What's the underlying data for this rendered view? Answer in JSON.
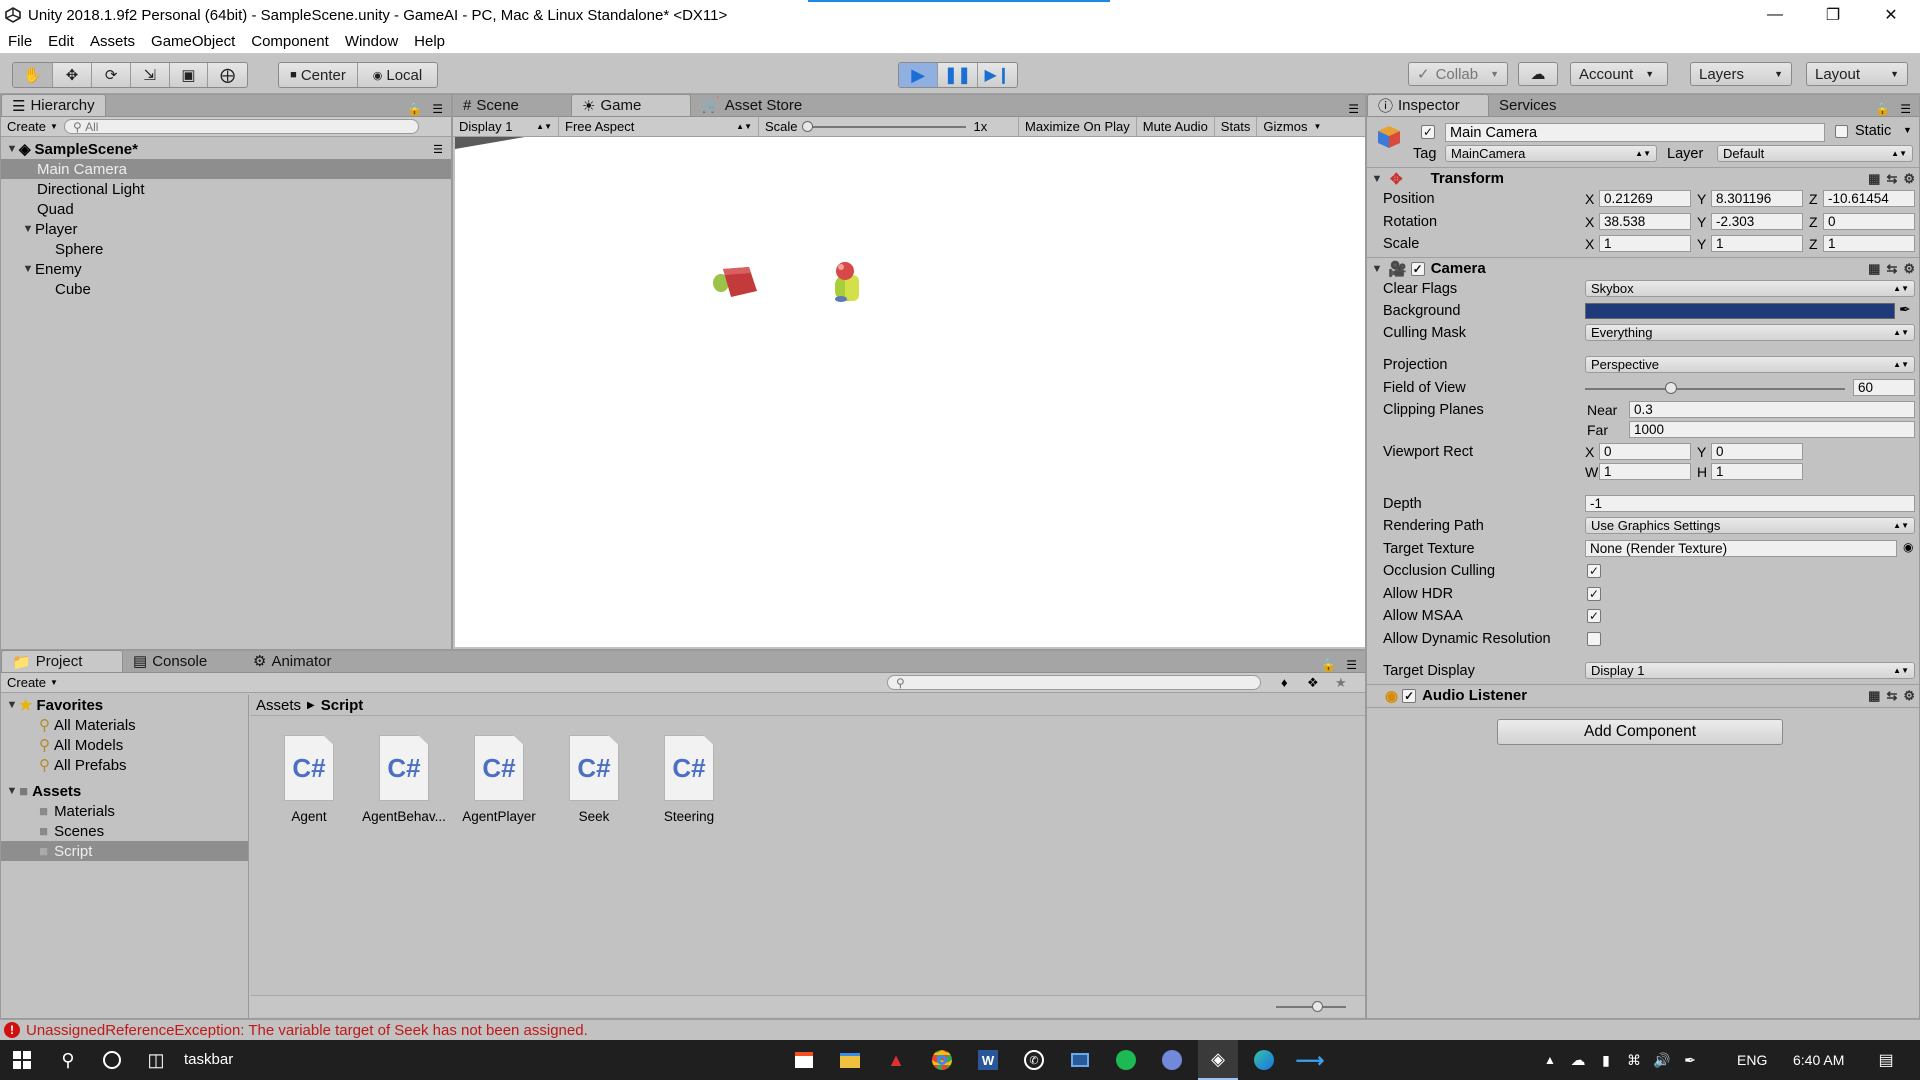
{
  "window": {
    "title": "Unity 2018.1.9f2 Personal (64bit) - SampleScene.unity - GameAI - PC, Mac & Linux Standalone* <DX11>",
    "min_icon": "minimize-icon",
    "max_icon": "restore-icon",
    "close_icon": "close-icon"
  },
  "menu": [
    "File",
    "Edit",
    "Assets",
    "GameObject",
    "Component",
    "Window",
    "Help"
  ],
  "toolbar": {
    "tools": [
      "hand-icon",
      "move-icon",
      "rotate-icon",
      "scale-icon",
      "rect-icon",
      "transform-icon"
    ],
    "pivot": "Center",
    "space": "Local",
    "play_state": "playing",
    "collab": "Collab",
    "account": "Account",
    "layers": "Layers",
    "layout": "Layout"
  },
  "hierarchy": {
    "tab": "Hierarchy",
    "create": "Create",
    "search_placeholder": "All",
    "scene": "SampleScene*",
    "items": [
      {
        "label": "Main Camera",
        "selected": true
      },
      {
        "label": "Directional Light"
      },
      {
        "label": "Quad"
      },
      {
        "label": "Player"
      },
      {
        "label": "Sphere"
      },
      {
        "label": "Enemy"
      },
      {
        "label": "Cube"
      }
    ]
  },
  "center_tabs": {
    "scene": "Scene",
    "game": "Game",
    "store": "Asset Store"
  },
  "game_toolbar": {
    "display": "Display 1",
    "aspect": "Free Aspect",
    "scale_label": "Scale",
    "scale_value": "1x",
    "maximize": "Maximize On Play",
    "mute": "Mute Audio",
    "stats": "Stats",
    "gizmos": "Gizmos"
  },
  "inspector": {
    "tab": "Inspector",
    "services": "Services",
    "object_name": "Main Camera",
    "static_label": "Static",
    "tag_label": "Tag",
    "tag": "MainCamera",
    "layer_label": "Layer",
    "layer": "Default",
    "transform": {
      "title": "Transform",
      "position_label": "Position",
      "pos": [
        "0.21269",
        "8.301196",
        "-10.61454"
      ],
      "rotation_label": "Rotation",
      "rot": [
        "38.538",
        "-2.303",
        "0"
      ],
      "scale_label": "Scale",
      "scale": [
        "1",
        "1",
        "1"
      ]
    },
    "camera": {
      "title": "Camera",
      "clear_flags_label": "Clear Flags",
      "clear_flags": "Skybox",
      "background_label": "Background",
      "background_color": "#1e3a78",
      "culling_label": "Culling Mask",
      "culling": "Everything",
      "projection_label": "Projection",
      "projection": "Perspective",
      "fov_label": "Field of View",
      "fov": "60",
      "fov_fraction": 0.33,
      "clipping_label": "Clipping Planes",
      "near_label": "Near",
      "near": "0.3",
      "far_label": "Far",
      "far": "1000",
      "viewport_label": "Viewport Rect",
      "vx": "0",
      "vy": "0",
      "vw": "1",
      "vh": "1",
      "depth_label": "Depth",
      "depth": "-1",
      "render_path_label": "Rendering Path",
      "render_path": "Use Graphics Settings",
      "target_texture_label": "Target Texture",
      "target_texture": "None (Render Texture)",
      "occlusion_label": "Occlusion Culling",
      "hdr_label": "Allow HDR",
      "msaa_label": "Allow MSAA",
      "dynres_label": "Allow Dynamic Resolution",
      "target_display_label": "Target Display",
      "target_display": "Display 1"
    },
    "audio_listener": "Audio Listener",
    "add_component": "Add Component"
  },
  "project": {
    "tabs": [
      "Project",
      "Console",
      "Animator"
    ],
    "create": "Create",
    "favorites": "Favorites",
    "fav_items": [
      "All Materials",
      "All Models",
      "All Prefabs"
    ],
    "assets": "Assets",
    "folders": [
      "Materials",
      "Scenes",
      "Script"
    ],
    "breadcrumb_root": "Assets",
    "breadcrumb_leaf": "Script",
    "files": [
      "Agent",
      "AgentBehav...",
      "AgentPlayer",
      "Seek",
      "Steering"
    ],
    "file_glyph": "C#"
  },
  "status": "UnassignedReferenceException: The variable target of Seek has not been assigned.",
  "taskbar": {
    "search_text": "taskbar",
    "lang": "ENG",
    "time": "6:40 AM"
  }
}
